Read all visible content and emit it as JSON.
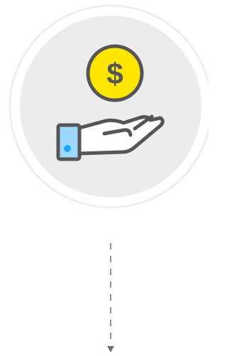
{
  "illustration": {
    "icon": "hand-holding-coin-icon",
    "coin_symbol": "$",
    "colors": {
      "outer_ring": "#eeeeee",
      "inner_circle": "#ececec",
      "coin_fill": "#ffe600",
      "outline": "#555555",
      "cuff_fill": "#9dd9ff",
      "cuff_button": "#1ea4ff",
      "hand_fill": "#ffffff",
      "arrow": "#6f6f6f"
    }
  },
  "connector": {
    "icon": "dashed-arrow-down-icon"
  }
}
